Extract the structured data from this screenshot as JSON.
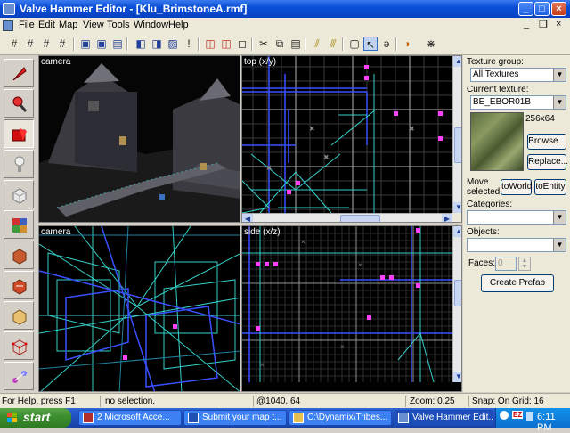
{
  "window": {
    "title": "Valve Hammer Editor - [Klu_BrimstoneA.rmf]"
  },
  "title_buttons": {
    "minimize": "_",
    "maximize": "□",
    "close": "×"
  },
  "doc_buttons": {
    "minimize": "_",
    "restore": "❐",
    "close": "×"
  },
  "menu": [
    "File",
    "Edit",
    "Map",
    "View",
    "Tools",
    "Window",
    "Help"
  ],
  "viewports": {
    "tl": "camera",
    "tr": "top (x/y)",
    "bl": "camera",
    "br": "side (x/z)"
  },
  "right_panel": {
    "texture_group_label": "Texture group:",
    "texture_group_value": "All Textures",
    "current_texture_label": "Current texture:",
    "current_texture_value": "BE_EBOR01B",
    "texture_size": "256x64",
    "browse": "Browse...",
    "replace": "Replace...",
    "move_selected_label": "Move selected:",
    "to_world": "toWorld",
    "to_entity": "toEntity",
    "categories_label": "Categories:",
    "objects_label": "Objects:",
    "faces_label": "Faces:",
    "faces_value": "0",
    "create_prefab": "Create Prefab"
  },
  "status": {
    "help": "For Help, press F1",
    "selection": "no selection.",
    "coords": "@1040, 64",
    "zoom": "Zoom: 0.25",
    "snap": "Snap: On Grid: 16"
  },
  "taskbar": {
    "start": "start",
    "tasks": [
      "2 Microsoft Acce...",
      "Submit your map t...",
      "C:\\Dynamix\\Tribes...",
      "Valve Hammer Edit..."
    ],
    "clock": "6:11 PM",
    "tray_badge": "EZ"
  },
  "colors": {
    "title_blue": "#0a4ed6",
    "wire_cyan": "#35d0c8",
    "wire_blue": "#3a50ff",
    "selection_magenta": "#ff40ff",
    "grid_gray": "#4a4a4a"
  }
}
